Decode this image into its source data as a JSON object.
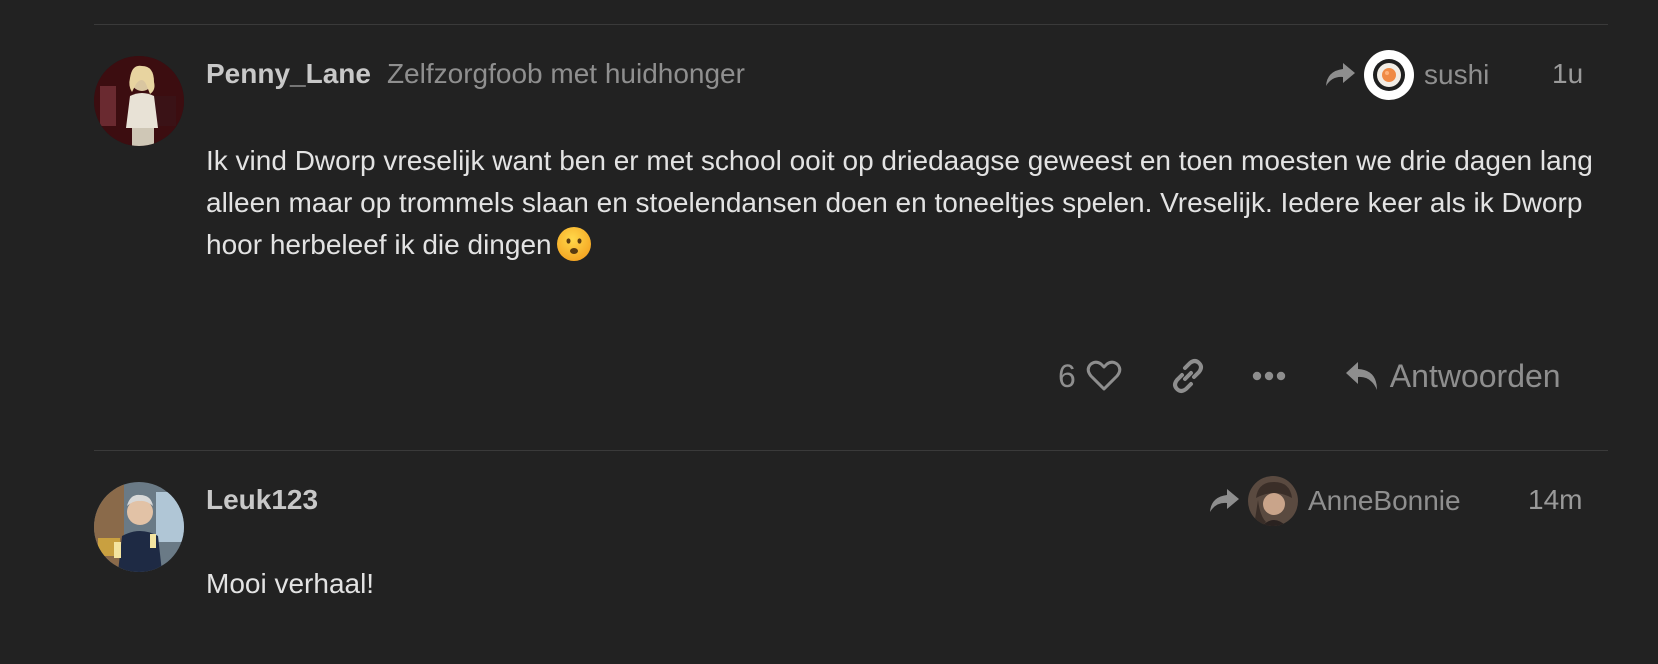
{
  "colors": {
    "background": "#222222",
    "divider": "#3a3a3a",
    "username": "#c8c8c8",
    "muted": "#8f8f8f",
    "body_text": "#e3e3e3"
  },
  "posts": [
    {
      "username": "Penny_Lane",
      "user_title": "Zelfzorgfoob met huidhonger",
      "reply_to": {
        "icon": "share-arrow-icon",
        "name": "sushi"
      },
      "date": "1u",
      "body": "Ik vind Dworp vreselijk want ben er met school ooit op driedaagse geweest en toen moesten we drie dagen lang alleen maar op trommels slaan en stoelendansen doen en toneeltjes spelen. Vreselijk. Iedere keer als ik Dworp hoor herbeleef ik die dingen",
      "emoji": "frowning-face-emoji",
      "actions": {
        "like_count": "6",
        "like_icon": "heart-icon",
        "link_icon": "link-icon",
        "more_icon": "more-dots-icon",
        "reply_icon": "reply-icon",
        "reply_label": "Antwoorden"
      }
    },
    {
      "username": "Leuk123",
      "reply_to": {
        "icon": "share-arrow-icon",
        "name": "AnneBonnie"
      },
      "date": "14m",
      "body": "Mooi verhaal!"
    }
  ]
}
